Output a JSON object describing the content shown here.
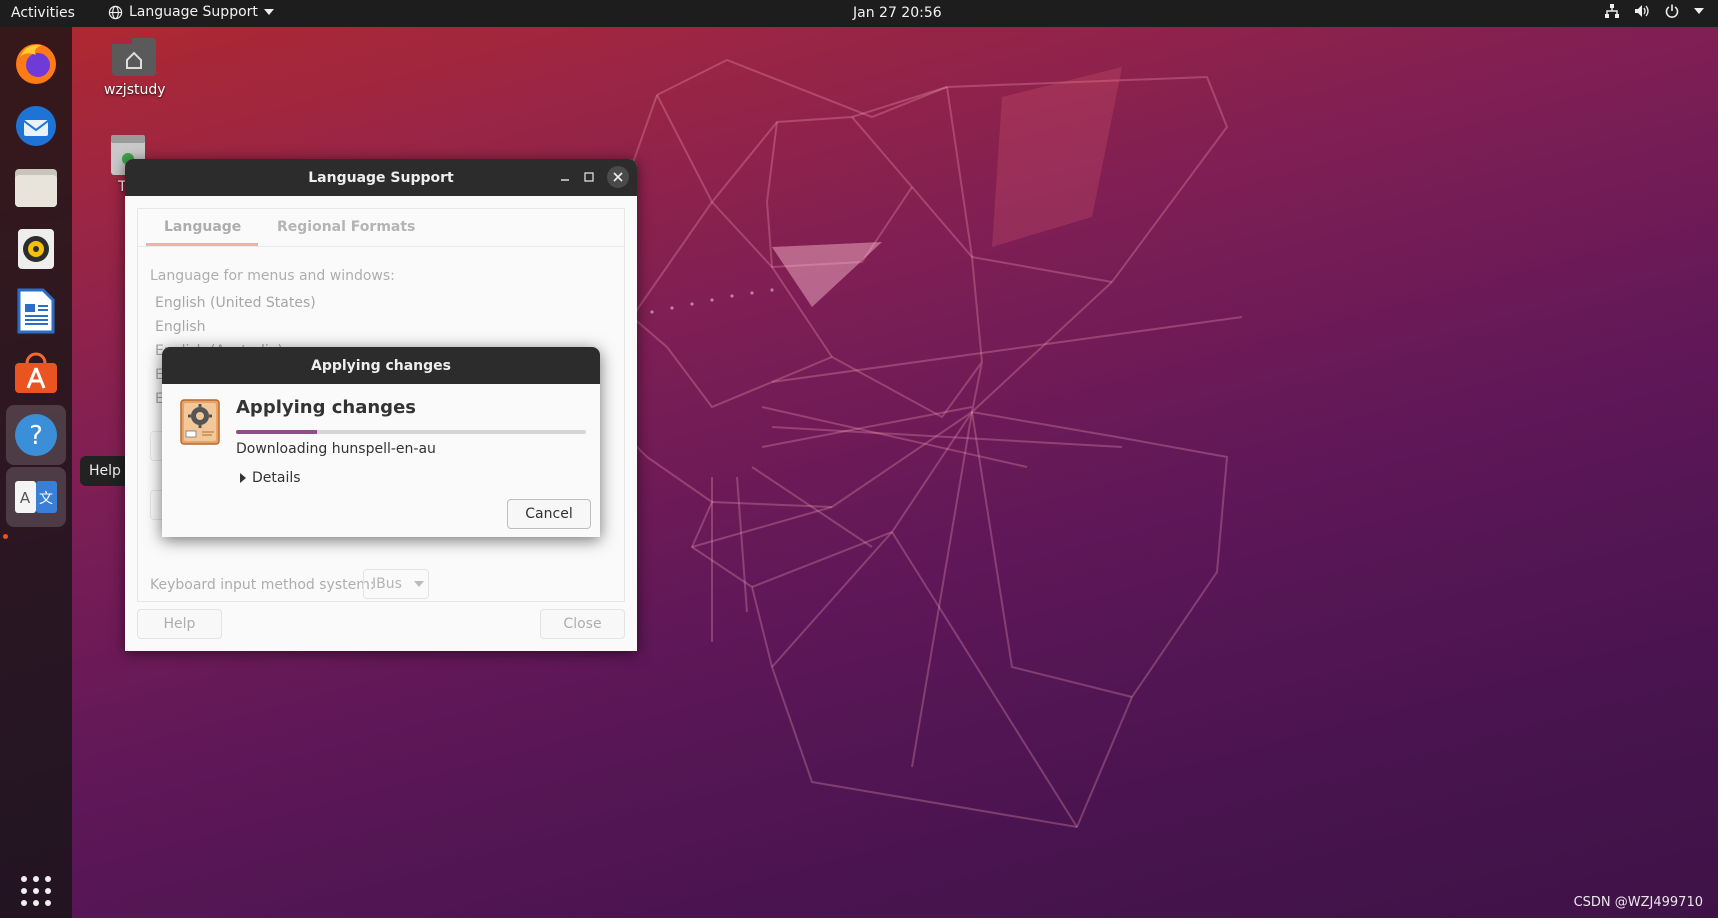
{
  "topbar": {
    "activities": "Activities",
    "app_menu": "Language Support",
    "clock": "Jan 27  20:56"
  },
  "dock": {
    "items": [
      "Firefox",
      "Thunderbird",
      "Files",
      "Rhythmbox",
      "LibreOffice Writer",
      "Ubuntu Software",
      "Help",
      "Language Support"
    ],
    "tooltip": "Help"
  },
  "desktop": {
    "home_icon_label": "wzjstudy",
    "trash_label_partial": "T"
  },
  "language_support": {
    "title": "Language Support",
    "tabs": [
      "Language",
      "Regional Formats"
    ],
    "lang_label": "Language for menus and windows:",
    "languages": [
      "English (United States)",
      "English",
      "English (Australia)",
      "E",
      "E"
    ],
    "keyboard_label": "Keyboard input method system:",
    "keyboard_value": "IBus",
    "help_button": "Help",
    "close_button": "Close"
  },
  "dialog": {
    "title": "Applying changes",
    "heading": "Applying changes",
    "progress": 0.23,
    "status": "Downloading hunspell-en-au",
    "details": "Details",
    "cancel": "Cancel"
  },
  "watermark": "CSDN @WZJ499710",
  "colors": {
    "accent": "#e95420",
    "progress": "#924d8b",
    "topbar": "#1d1d1d"
  }
}
